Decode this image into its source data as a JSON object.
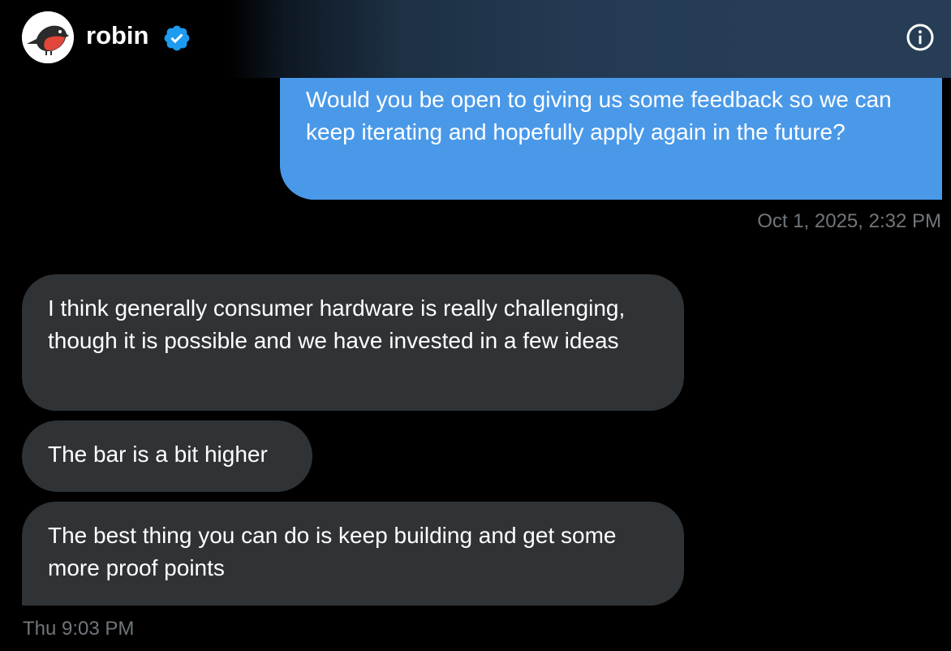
{
  "header": {
    "display_name": "robin",
    "verified_icon": "verified-badge-icon",
    "info_icon": "info-icon",
    "avatar_icon": "robin-bird-avatar"
  },
  "colors": {
    "outgoing_bubble": "#4a99e9",
    "incoming_bubble": "#2f3336",
    "verified_blue": "#1d9bf0",
    "timestamp_gray": "#71767b",
    "background": "#000000"
  },
  "messages": [
    {
      "direction": "outgoing",
      "text": "Would you be open to giving us some feedback so we can keep iterating and hopefully apply again in the future?"
    },
    {
      "direction": "incoming",
      "text": "I think generally consumer hardware is really challenging, though it is possible and we have invested in a few ideas"
    },
    {
      "direction": "incoming",
      "text": "The bar is a bit higher"
    },
    {
      "direction": "incoming",
      "text": "The best thing you can do is keep building and get some more proof points"
    }
  ],
  "timestamps": {
    "outgoing": "Oct 1, 2025, 2:32 PM",
    "incoming": "Thu 9:03 PM"
  }
}
